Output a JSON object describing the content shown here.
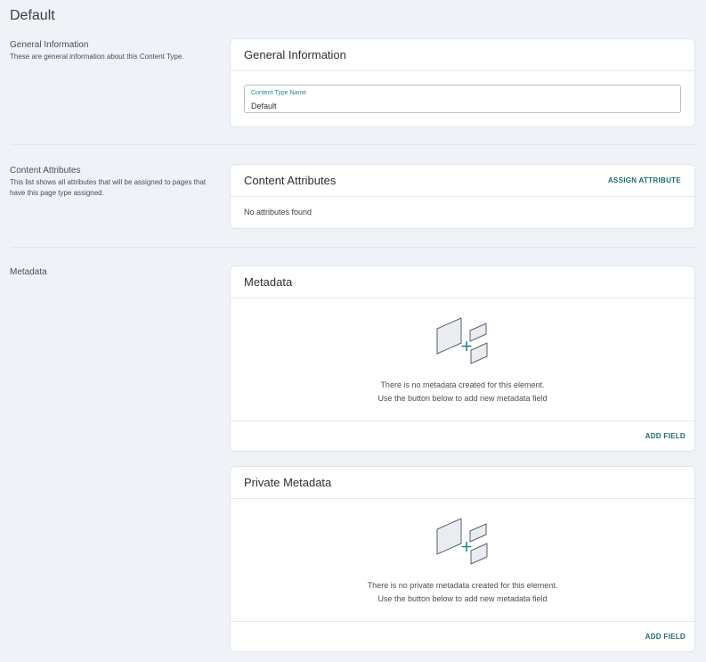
{
  "page": {
    "title": "Default"
  },
  "general": {
    "heading": "General Information",
    "description": "These are general information about this Content Type.",
    "card_title": "General Information",
    "field_label": "Content Type Name",
    "field_value": "Default"
  },
  "attributes": {
    "heading": "Content Attributes",
    "description": "This list shows all attributes that will be assigned to pages that have this page type assigned.",
    "card_title": "Content Attributes",
    "action_label": "ASSIGN ATTRIBUTE",
    "empty_text": "No attributes found"
  },
  "metadata": {
    "heading": "Metadata",
    "public": {
      "title": "Metadata",
      "empty_line1": "There is no metadata created for this element.",
      "empty_line2": "Use the button below to add new metadata field",
      "action_label": "ADD FIELD"
    },
    "private": {
      "title": "Private Metadata",
      "empty_line1": "There is no private metadata created for this element.",
      "empty_line2": "Use the button below to add new metadata field",
      "action_label": "ADD FIELD"
    }
  },
  "colors": {
    "background": "#eff3f7",
    "accent": "#1d6b6e",
    "label_accent": "#1d8b8e"
  },
  "icons": {
    "empty_state": "add-metadata-illustration-icon"
  }
}
